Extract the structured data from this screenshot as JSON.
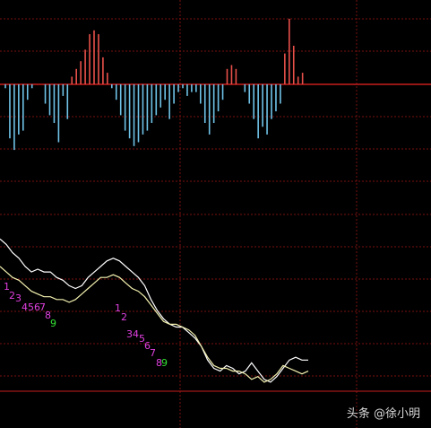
{
  "watermark": "头条 @徐小明",
  "colors": {
    "background": "#000000",
    "grid": "#7a1010",
    "axis": "#c81e1e",
    "bar_up": "#e8504a",
    "bar_down": "#6fc3e8",
    "line_fast": "#ffffff",
    "line_slow": "#f4f2b0",
    "count_label": "#e040e0",
    "count_label_final": "#33e033"
  },
  "chart_data": [
    {
      "type": "bar",
      "subtype": "macd-histogram",
      "note_values": "values relative to zero line (positive up, negative down)",
      "values": [
        -1,
        -14,
        -17,
        -13,
        -12,
        -4,
        -1,
        0,
        0,
        -5,
        -8,
        -10,
        -15,
        -3,
        -9,
        2,
        4,
        6,
        9,
        13,
        14,
        13,
        7,
        3,
        -1,
        -4,
        -8,
        -12,
        -14,
        -16,
        -15,
        -13,
        -12,
        -10,
        -8,
        -6,
        -4,
        -9,
        -5,
        -2,
        -1,
        -3,
        -2,
        -2,
        -5,
        -10,
        -13,
        -10,
        -7,
        -4,
        4,
        5,
        4,
        0,
        -2,
        -5,
        -9,
        -14,
        -11,
        -13,
        -9,
        -7,
        -5,
        8,
        17,
        10,
        2,
        3
      ],
      "ylim": [
        -28,
        22
      ]
    },
    {
      "type": "line",
      "series": [
        {
          "values": [
            52,
            50,
            47,
            45,
            42,
            40,
            41,
            40,
            40,
            38,
            37,
            35,
            34,
            35,
            38,
            40,
            42,
            44,
            45,
            44,
            42,
            40,
            38,
            35,
            30,
            26,
            23,
            21,
            20,
            20,
            18,
            16,
            13,
            8,
            5,
            4,
            6,
            5,
            3,
            4,
            7,
            4,
            1,
            0,
            2,
            5,
            8,
            9,
            8,
            8
          ]
        },
        {
          "values": [
            42,
            40,
            38,
            37,
            35,
            33,
            32,
            31,
            31,
            30,
            30,
            29,
            30,
            32,
            34,
            36,
            38,
            38,
            39,
            38,
            36,
            34,
            33,
            31,
            28,
            25,
            22,
            21,
            21,
            20,
            19,
            17,
            13,
            9,
            6,
            5,
            5,
            4,
            4,
            3,
            1,
            2,
            0,
            1,
            3,
            6,
            5,
            4,
            3,
            4
          ]
        }
      ],
      "ylim": [
        -2,
        56
      ]
    }
  ],
  "sequence_labels": [
    {
      "text": "1",
      "final": false
    },
    {
      "text": "2",
      "final": false
    },
    {
      "text": "3",
      "final": false
    },
    {
      "text": "4",
      "final": false
    },
    {
      "text": "5",
      "final": false
    },
    {
      "text": "6",
      "final": false
    },
    {
      "text": "7",
      "final": false
    },
    {
      "text": "8",
      "final": false
    },
    {
      "text": "9",
      "final": true
    },
    {
      "text": "1",
      "final": false
    },
    {
      "text": "2",
      "final": false
    },
    {
      "text": "3",
      "final": false
    },
    {
      "text": "4",
      "final": false
    },
    {
      "text": "5",
      "final": false
    },
    {
      "text": "6",
      "final": false
    },
    {
      "text": "7",
      "final": false
    },
    {
      "text": "8",
      "final": false
    },
    {
      "text": "9",
      "final": true
    }
  ]
}
